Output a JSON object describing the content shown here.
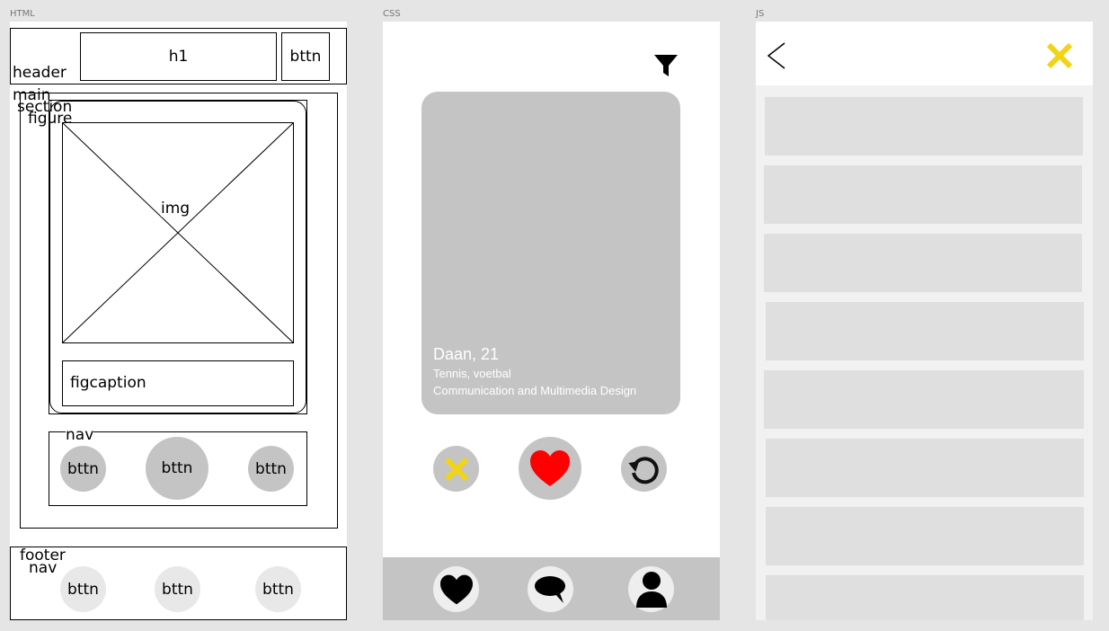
{
  "labels": {
    "html": "HTML",
    "css": "CSS",
    "js": "JS"
  },
  "wireframe": {
    "header": "header",
    "h1": "h1",
    "header_button": "bttn",
    "main": "main",
    "section": "section",
    "figure": "figure",
    "img": "img",
    "figcaption": "figcaption",
    "nav": "nav",
    "nav_buttons": [
      "bttn",
      "bttn",
      "bttn"
    ],
    "footer": "footer",
    "footer_nav": "nav",
    "footer_buttons": [
      "bttn",
      "bttn",
      "bttn"
    ]
  },
  "css_mock": {
    "profile_name": "Daan, 21",
    "interests": "Tennis, voetbal",
    "study": "Communication and Multimedia Design",
    "icons": [
      "filter-icon",
      "close-icon",
      "heart-icon",
      "undo-icon",
      "heart-icon",
      "chat-icon",
      "user-icon"
    ],
    "colors": {
      "accent_yellow": "#f2d416",
      "heart_red": "#ff0000",
      "card_gray": "#c4c4c4"
    }
  },
  "js_mock": {
    "icons": [
      "back-icon",
      "close-icon"
    ],
    "list_item_count": 8,
    "colors": {
      "accent_yellow": "#f2d416",
      "list_bg": "#f1f1f1",
      "item_gray": "#dfdfdf"
    }
  }
}
